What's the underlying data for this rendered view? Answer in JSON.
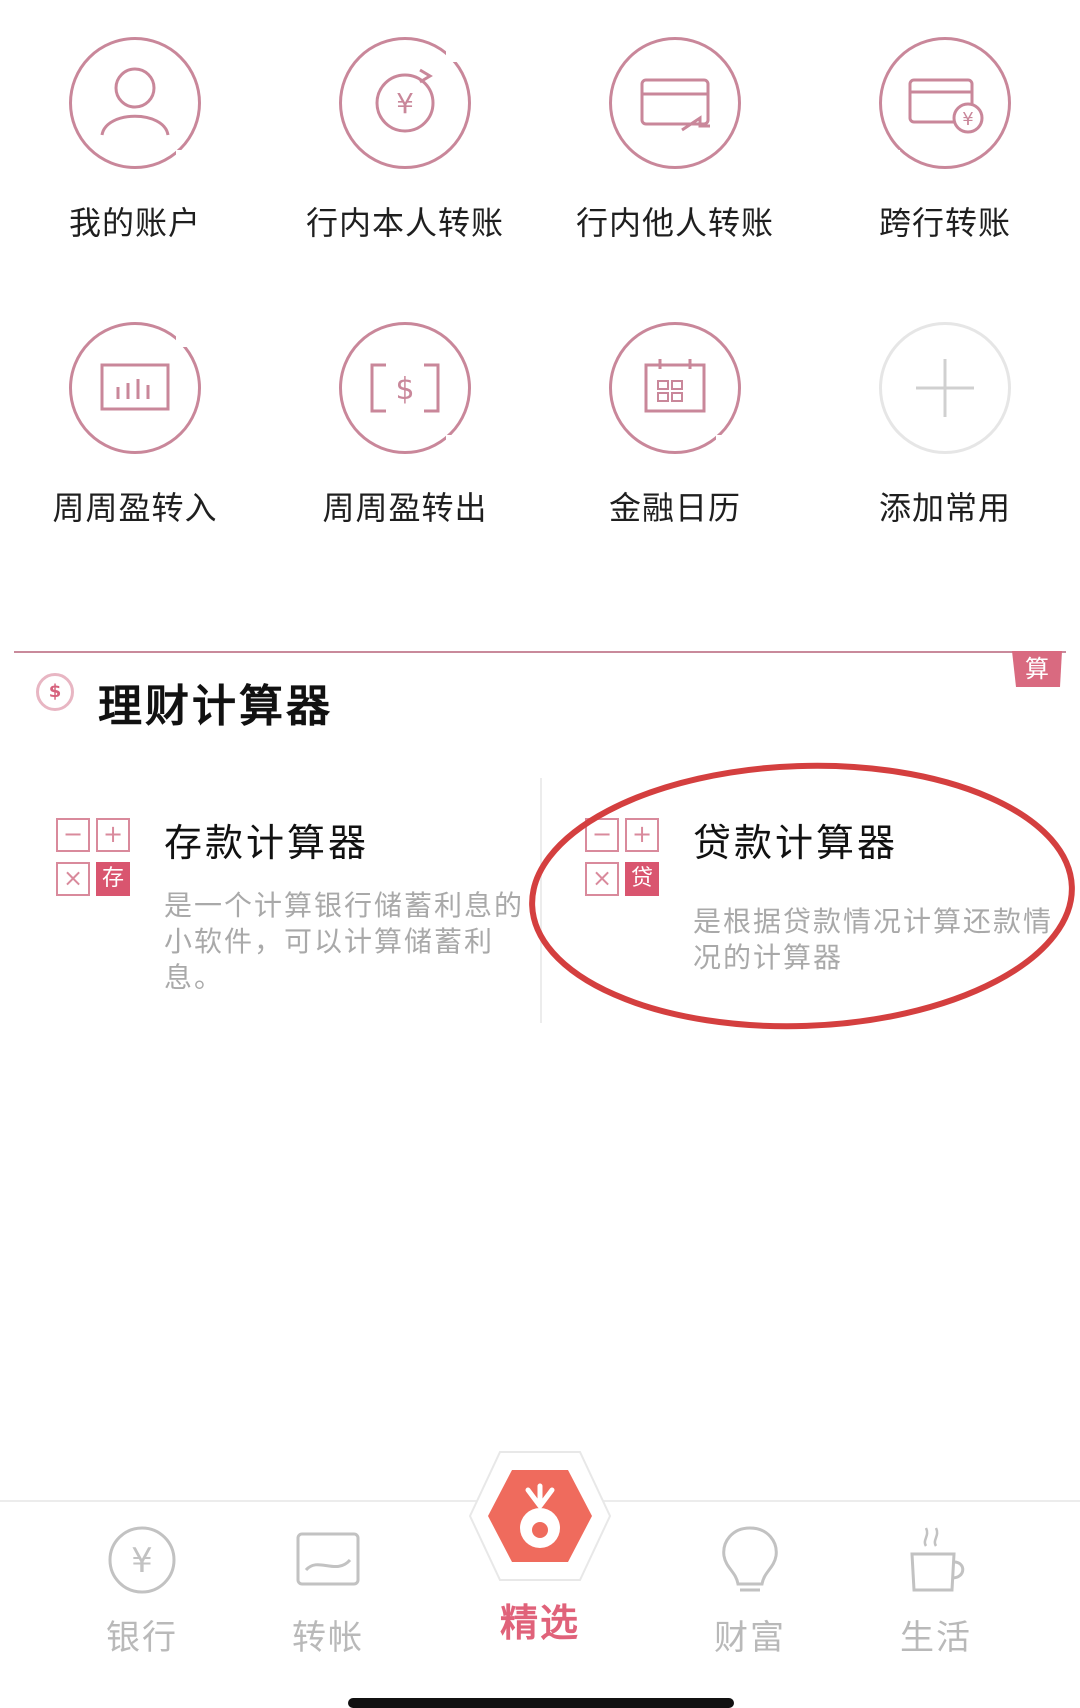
{
  "quick_actions": [
    {
      "label": "我的账户",
      "icon": "user-icon"
    },
    {
      "label": "行内本人转账",
      "icon": "yuan-transfer-icon"
    },
    {
      "label": "行内他人转账",
      "icon": "card-transfer-icon"
    },
    {
      "label": "跨行转账",
      "icon": "card-yuan-icon"
    },
    {
      "label": "周周盈转入",
      "icon": "chart-in-icon"
    },
    {
      "label": "周周盈转出",
      "icon": "dollar-out-icon"
    },
    {
      "label": "金融日历",
      "icon": "calendar-icon"
    },
    {
      "label": "添加常用",
      "icon": "plus-icon"
    }
  ],
  "calculator_section": {
    "icon": "dollar-coin-icon",
    "title": "理财计算器",
    "corner_tag": "算",
    "deposit": {
      "title": "存款计算器",
      "key_label": "存",
      "description_lines": [
        "是一个计算银行储蓄利息的",
        "小软件，可以计算储蓄利",
        "息。"
      ]
    },
    "loan": {
      "title": "贷款计算器",
      "key_label": "贷",
      "description_lines": [
        "是根据贷款情况计算还款情",
        "况的计算器"
      ]
    },
    "key_symbols": {
      "minus": "−",
      "plus": "+",
      "times": "×"
    }
  },
  "tabbar": {
    "tabs": [
      {
        "label": "银行",
        "icon": "yuan-coin-icon",
        "active": false
      },
      {
        "label": "转帐",
        "icon": "transfer-icon",
        "active": false
      },
      {
        "label": "精选",
        "icon": "featured-hex-icon",
        "active": true
      },
      {
        "label": "财富",
        "icon": "lightbulb-icon",
        "active": false
      },
      {
        "label": "生活",
        "icon": "coffee-cup-icon",
        "active": false
      }
    ]
  },
  "colors": {
    "accent": "#d9556f",
    "ring": "#c9879a",
    "annotation": "#d43f3f",
    "muted_text": "#a9a9a9",
    "tab_inactive": "#b9b9b9"
  }
}
